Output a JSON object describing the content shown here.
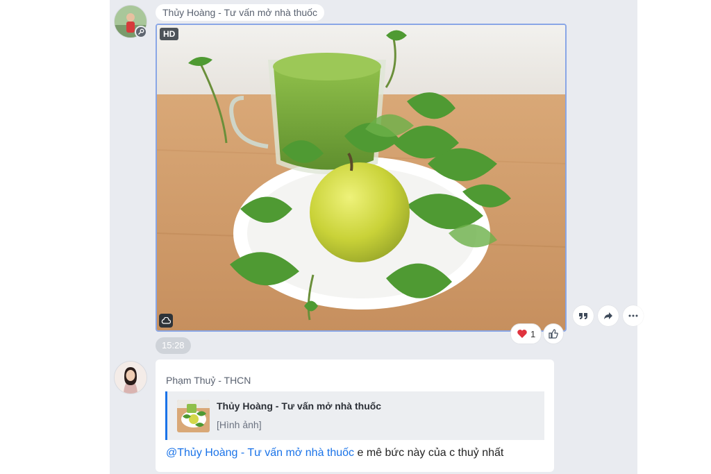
{
  "message1": {
    "sender": "Thủy Hoàng - Tư vấn mở nhà thuốc",
    "quality_badge": "HD",
    "time": "15:28",
    "reaction": {
      "icon": "heart-icon",
      "count": "1"
    },
    "actions": [
      "quote-icon",
      "share-icon",
      "more-icon"
    ]
  },
  "message2": {
    "sender": "Phạm Thuỷ - THCN",
    "quote": {
      "title": "Thủy Hoàng - Tư vấn mở nhà thuốc",
      "subtitle": "[Hình ảnh]"
    },
    "mention": "@Thủy Hoàng - Tư vấn mở nhà thuốc",
    "text": " e mê bức này của c thuỷ nhất"
  },
  "colors": {
    "chat_bg": "#e9ebf0",
    "mention": "#1a73e8",
    "heart": "#e0333e"
  }
}
